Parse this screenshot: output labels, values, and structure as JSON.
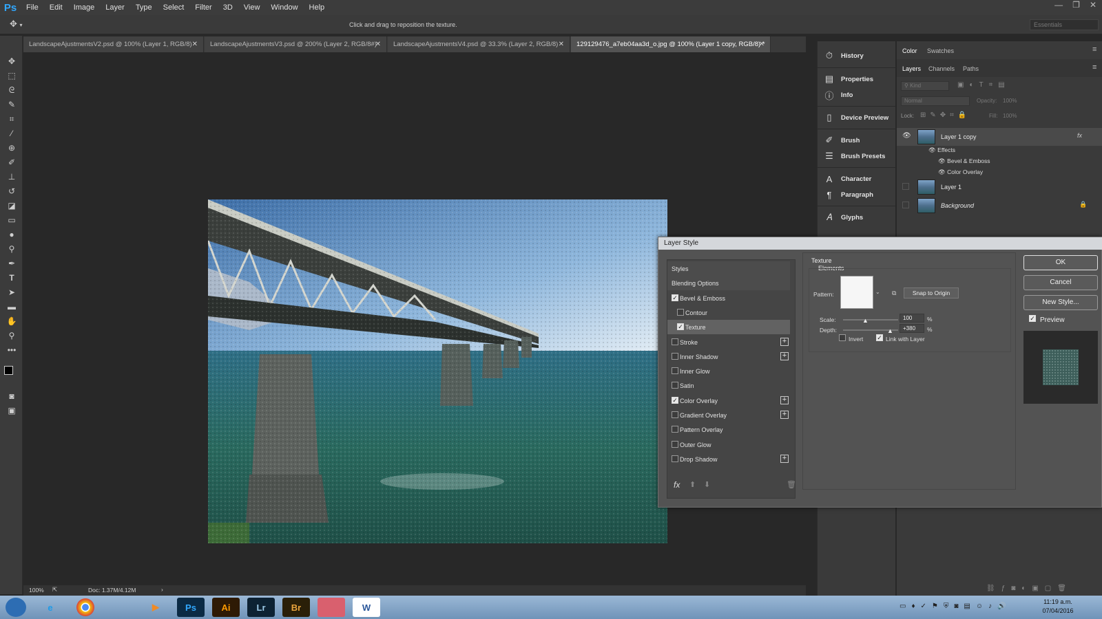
{
  "app": {
    "logo": "Ps",
    "menu": [
      "File",
      "Edit",
      "Image",
      "Layer",
      "Type",
      "Select",
      "Filter",
      "3D",
      "View",
      "Window",
      "Help"
    ],
    "window_controls": [
      "—",
      "❐",
      "✕"
    ]
  },
  "options_bar": {
    "hint": "Click and drag to reposition the texture.",
    "workspace": "Essentials"
  },
  "tabs": [
    {
      "label": "LandscapeAjustmentsV2.psd @ 100% (Layer 1, RGB/8)"
    },
    {
      "label": "LandscapeAjustmentsV3.psd @ 200% (Layer 2, RGB/8#)"
    },
    {
      "label": "LandscapeAjustmentsV4.psd @ 33.3% (Layer 2, RGB/8)"
    },
    {
      "label": "129129476_a7eb04aa3d_o.jpg @ 100% (Layer 1 copy, RGB/8) *"
    }
  ],
  "status": {
    "zoom": "100%",
    "doc": "Doc: 1.37M/4.12M",
    "arrow": "›"
  },
  "dock": {
    "items": [
      {
        "label": "History",
        "icon": "history-icon"
      },
      {
        "label": "Properties",
        "icon": "properties-icon"
      },
      {
        "label": "Info",
        "icon": "info-icon"
      },
      {
        "label": "Device Preview",
        "icon": "device-preview-icon"
      },
      {
        "label": "Brush",
        "icon": "brush-icon"
      },
      {
        "label": "Brush Presets",
        "icon": "brush-presets-icon"
      },
      {
        "label": "Character",
        "icon": "character-icon"
      },
      {
        "label": "Paragraph",
        "icon": "paragraph-icon"
      },
      {
        "label": "Glyphs",
        "icon": "glyphs-icon"
      }
    ]
  },
  "color_panel": {
    "tabs": [
      "Color",
      "Swatches"
    ]
  },
  "layers_panel": {
    "tabs": [
      "Layers",
      "Channels",
      "Paths"
    ],
    "kind_placeholder": "Kind",
    "blend_mode": "Normal",
    "opacity_label": "Opacity:",
    "opacity_value": "100%",
    "lock_label": "Lock:",
    "fill_label": "Fill:",
    "fill_value": "100%",
    "layers": [
      {
        "name": "Layer 1 copy",
        "fx": "fx"
      },
      {
        "name": "Layer 1"
      },
      {
        "name": "Background"
      }
    ],
    "effects_label": "Effects",
    "effects": [
      "Bevel & Emboss",
      "Color Overlay"
    ]
  },
  "dialog": {
    "title": "Layer Style",
    "styles": [
      {
        "label": "Styles",
        "type": "header"
      },
      {
        "label": "Blending Options",
        "type": "header"
      },
      {
        "label": "Bevel & Emboss",
        "checked": true
      },
      {
        "label": "Contour",
        "checked": false,
        "indent": true
      },
      {
        "label": "Texture",
        "checked": true,
        "indent": true,
        "selected": true
      },
      {
        "label": "Stroke",
        "checked": false,
        "plus": true
      },
      {
        "label": "Inner Shadow",
        "checked": false,
        "plus": true
      },
      {
        "label": "Inner Glow",
        "checked": false
      },
      {
        "label": "Satin",
        "checked": false
      },
      {
        "label": "Color Overlay",
        "checked": true,
        "plus": true
      },
      {
        "label": "Gradient Overlay",
        "checked": false,
        "plus": true
      },
      {
        "label": "Pattern Overlay",
        "checked": false
      },
      {
        "label": "Outer Glow",
        "checked": false
      },
      {
        "label": "Drop Shadow",
        "checked": false,
        "plus": true
      }
    ],
    "texture": {
      "section": "Texture",
      "group": "Elements",
      "pattern_label": "Pattern:",
      "snap_button": "Snap to Origin",
      "scale_label": "Scale:",
      "scale_value": "100",
      "scale_fraction": 0.4,
      "depth_label": "Depth:",
      "depth_value": "+380",
      "depth_fraction": 0.85,
      "unit": "%",
      "invert_label": "Invert",
      "invert_checked": false,
      "link_label": "Link with Layer",
      "link_checked": true
    },
    "buttons": {
      "ok": "OK",
      "cancel": "Cancel",
      "new_style": "New Style...",
      "preview": "Preview"
    },
    "preview_checked": true,
    "footer_fx": "fx"
  },
  "taskbar": {
    "apps": [
      {
        "label": "",
        "name": "start-orb"
      },
      {
        "label": "e",
        "name": "internet-explorer-icon"
      },
      {
        "label": "",
        "name": "chrome-icon"
      },
      {
        "label": "",
        "name": "file-explorer-icon"
      },
      {
        "label": "▶",
        "name": "media-player-icon"
      },
      {
        "label": "Ps",
        "name": "photoshop-task-icon"
      },
      {
        "label": "Ai",
        "name": "illustrator-task-icon"
      },
      {
        "label": "Lr",
        "name": "lightroom-task-icon"
      },
      {
        "label": "Br",
        "name": "bridge-task-icon"
      },
      {
        "label": "",
        "name": "snipping-tool-icon"
      },
      {
        "label": "W",
        "name": "word-task-icon"
      }
    ],
    "time": "11:19 a.m.",
    "date": "07/04/2016"
  },
  "colors": {
    "accent": "#31a8ff",
    "panel": "#3a3a3a",
    "canvas": "#282828",
    "dialog": "#535353"
  }
}
